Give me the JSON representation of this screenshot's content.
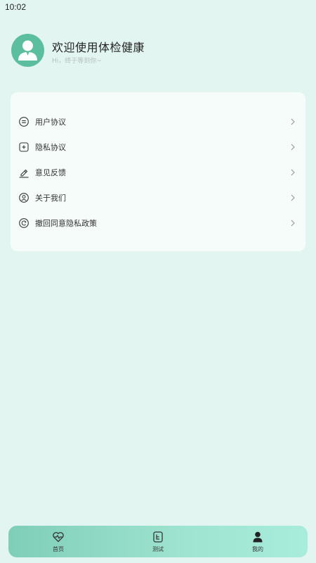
{
  "status_bar": {
    "time": "10:02"
  },
  "profile": {
    "title": "欢迎使用体检健康",
    "subtitle": "Hi，终于等到你~",
    "avatar_icon": "person-avatar-icon",
    "avatar_color": "#5bbf9f"
  },
  "menu": {
    "items": [
      {
        "label": "用户协议",
        "icon": "user-agreement-icon"
      },
      {
        "label": "隐私协议",
        "icon": "privacy-agreement-icon"
      },
      {
        "label": "意见反馈",
        "icon": "feedback-pen-icon"
      },
      {
        "label": "关于我们",
        "icon": "about-us-icon"
      },
      {
        "label": "撤回同意隐私政策",
        "icon": "revoke-consent-icon"
      }
    ],
    "chevron_icon": "chevron-right-icon"
  },
  "bottom_nav": {
    "items": [
      {
        "label": "首页",
        "icon": "heart-pulse-icon"
      },
      {
        "label": "测试",
        "icon": "test-card-icon"
      },
      {
        "label": "我的",
        "icon": "person-icon",
        "active": true
      }
    ],
    "gradient_start": "#7fceb8",
    "gradient_end": "#a8ecdc"
  }
}
